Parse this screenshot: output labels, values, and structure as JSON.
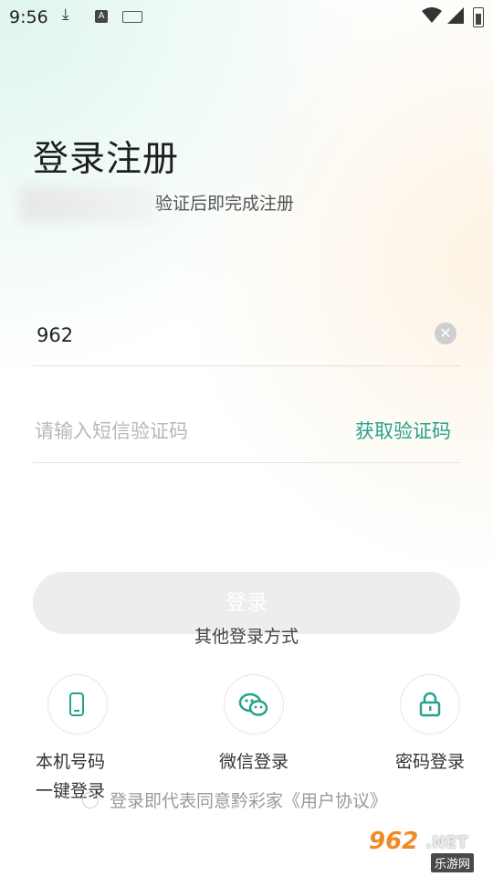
{
  "status_bar": {
    "time": "9:56",
    "icons": [
      "download-icon",
      "text-a-icon",
      "keyboard-icon",
      "wifi-icon",
      "signal-icon",
      "battery-charging-icon"
    ],
    "a_glyph": "A"
  },
  "header": {
    "title": "登录注册",
    "subtitle": "验证后即完成注册"
  },
  "form": {
    "phone_value": "962",
    "code_placeholder": "请输入短信验证码",
    "get_code_label": "获取验证码",
    "login_label": "登录"
  },
  "other_methods": {
    "label": "其他登录方式",
    "items": [
      {
        "label_line1": "本机号码",
        "label_line2": "一键登录",
        "icon": "phone-icon"
      },
      {
        "label_line1": "微信登录",
        "icon": "wechat-icon"
      },
      {
        "label_line1": "密码登录",
        "icon": "lock-icon"
      }
    ]
  },
  "agreement": {
    "text": "登录即代表同意黔彩家《用户协议》"
  },
  "watermark": {
    "number": "962",
    "suffix": ".NET",
    "cn": "乐游网"
  },
  "colors": {
    "accent": "#25a38a",
    "button_disabled": "#ededed",
    "watermark_orange": "#f08a24"
  }
}
